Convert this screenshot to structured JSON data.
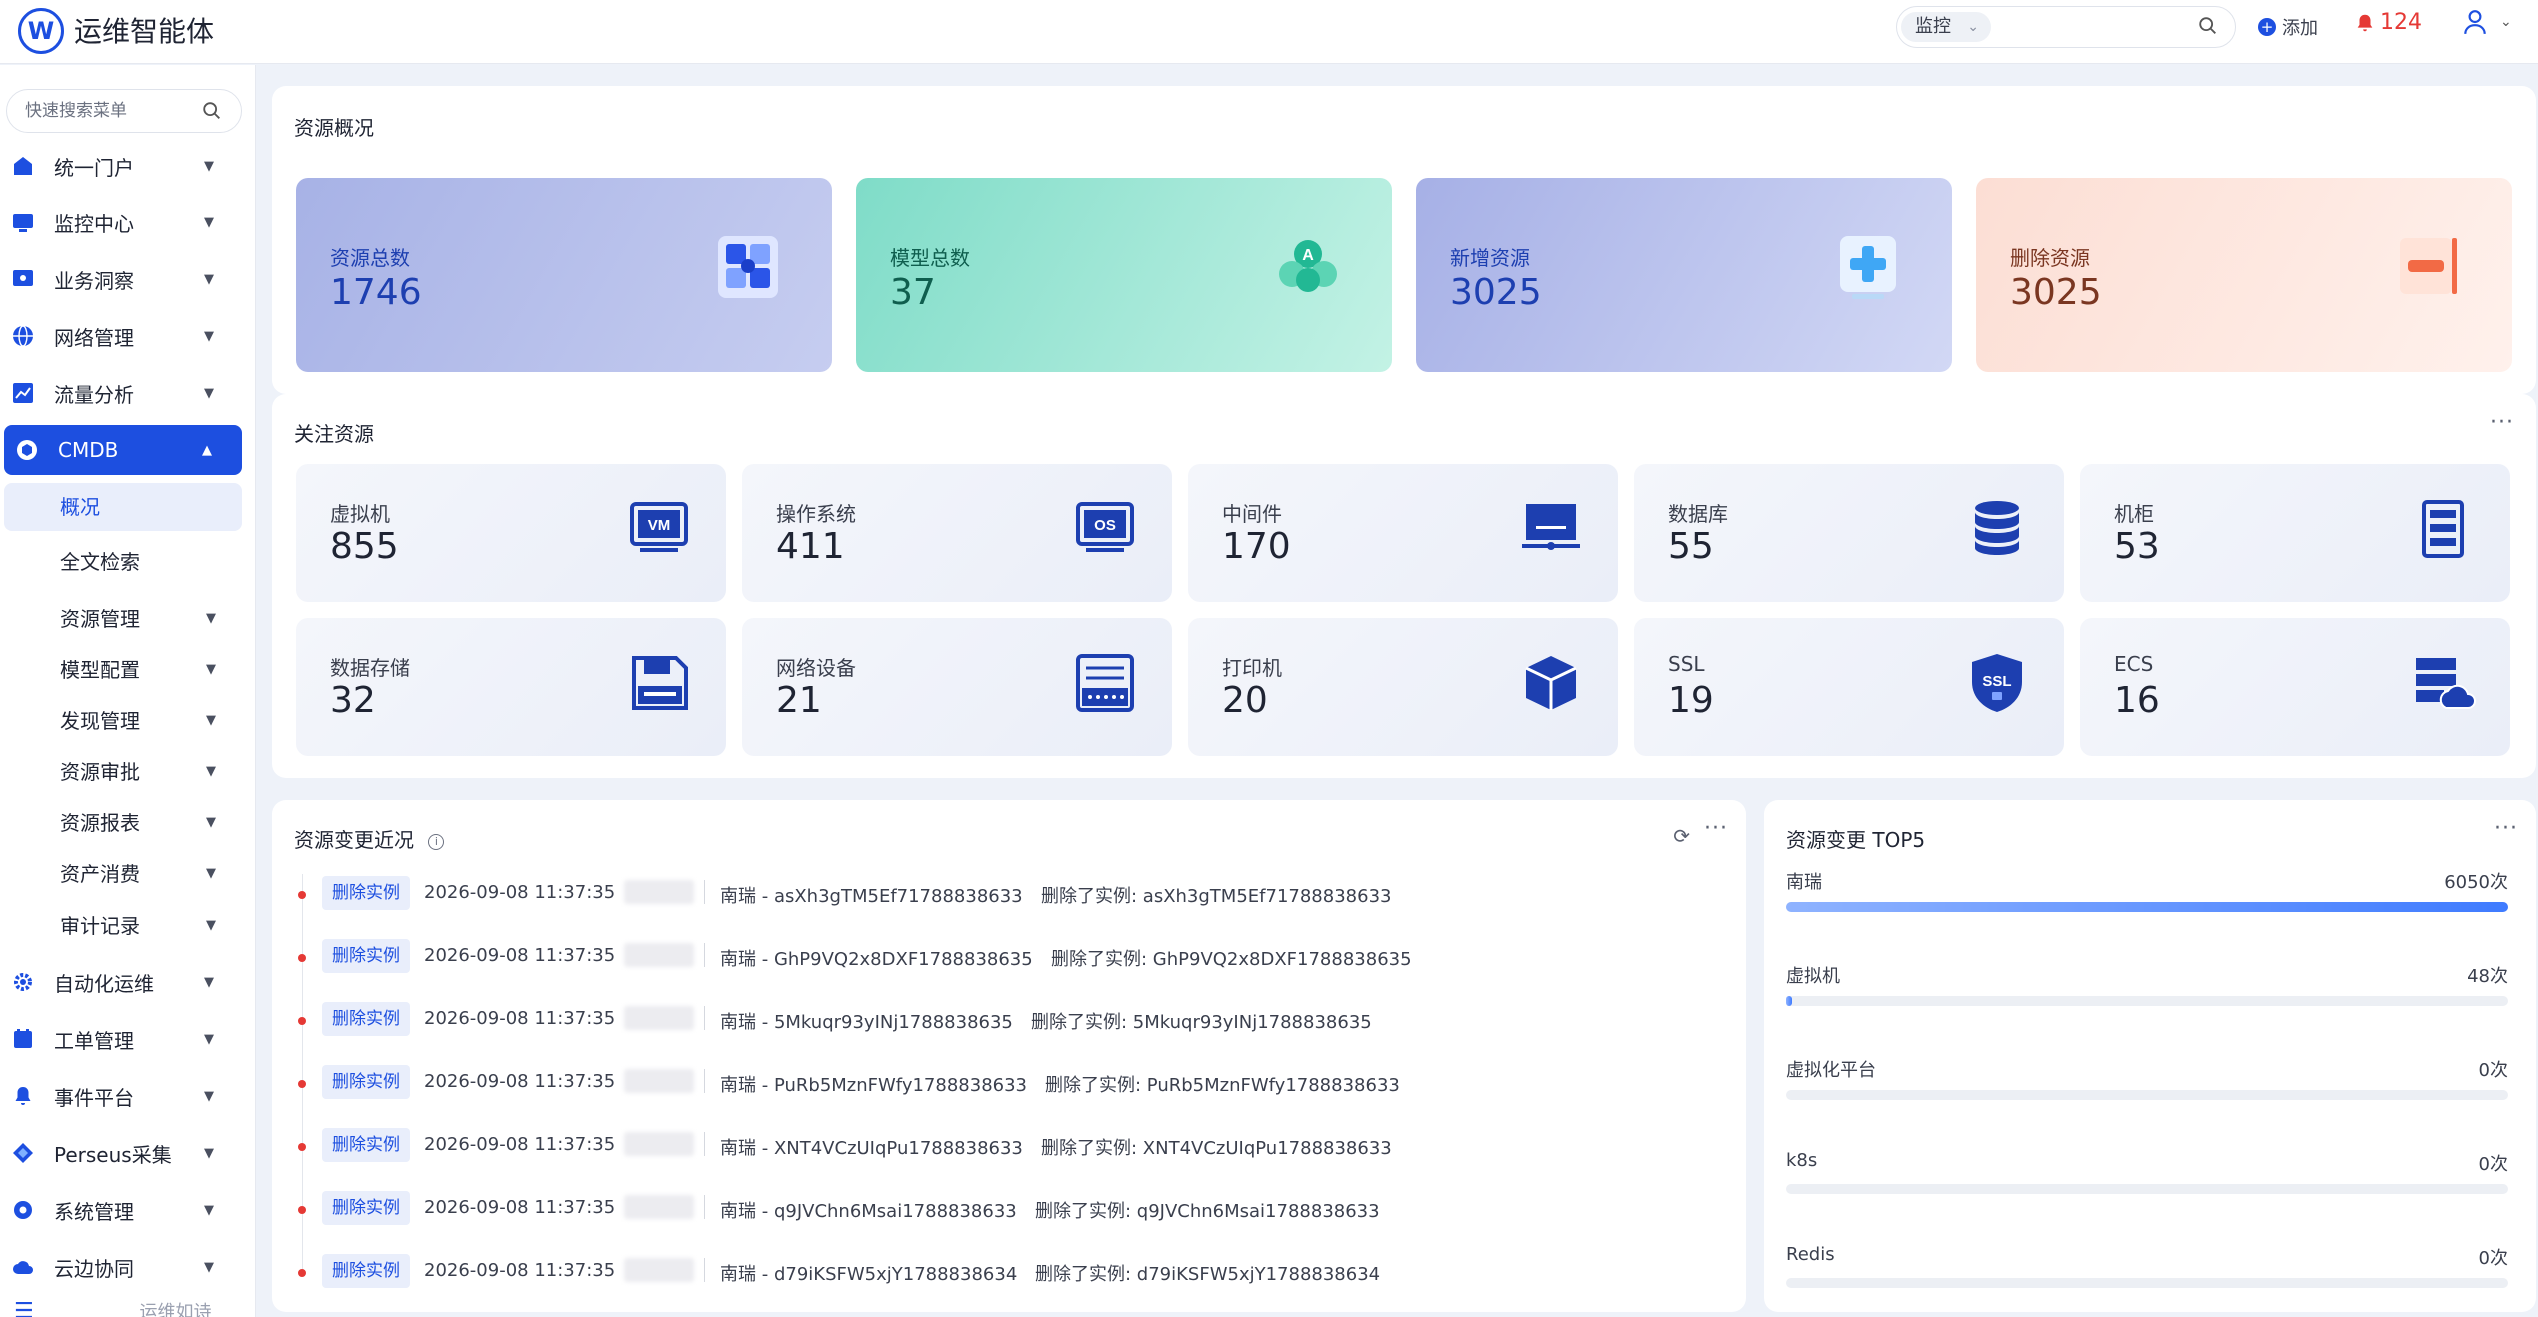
{
  "header": {
    "app_title": "运维智能体",
    "search_scope": "监控",
    "add_label": "添加",
    "alert_count": "124"
  },
  "sidebar": {
    "search_placeholder": "快速搜索菜单",
    "items": [
      {
        "label": "统一门户",
        "icon": "portal-icon"
      },
      {
        "label": "监控中心",
        "icon": "monitor-icon"
      },
      {
        "label": "业务洞察",
        "icon": "insight-icon"
      },
      {
        "label": "网络管理",
        "icon": "globe-icon"
      },
      {
        "label": "流量分析",
        "icon": "chart-icon"
      },
      {
        "label": "CMDB",
        "icon": "cmdb-icon"
      },
      {
        "label": "自动化运维",
        "icon": "gear-icon"
      },
      {
        "label": "工单管理",
        "icon": "ticket-icon"
      },
      {
        "label": "事件平台",
        "icon": "bell-icon"
      },
      {
        "label": "Perseus采集",
        "icon": "diamond-icon"
      },
      {
        "label": "系统管理",
        "icon": "settings-icon"
      },
      {
        "label": "云边协同",
        "icon": "cloud-icon"
      }
    ],
    "cmdb_sub": [
      {
        "label": "概况"
      },
      {
        "label": "全文检索"
      },
      {
        "label": "资源管理"
      },
      {
        "label": "模型配置"
      },
      {
        "label": "发现管理"
      },
      {
        "label": "资源审批"
      },
      {
        "label": "资源报表"
      },
      {
        "label": "资产消费"
      },
      {
        "label": "审计记录"
      }
    ],
    "footer": "运维如诗"
  },
  "overview": {
    "title": "资源概况",
    "cards": [
      {
        "label": "资源总数",
        "value": "1746"
      },
      {
        "label": "模型总数",
        "value": "37"
      },
      {
        "label": "新增资源",
        "value": "3025"
      },
      {
        "label": "删除资源",
        "value": "3025"
      }
    ]
  },
  "focus": {
    "title": "关注资源",
    "cards": [
      {
        "label": "虚拟机",
        "value": "855",
        "icon": "vm-icon"
      },
      {
        "label": "操作系统",
        "value": "411",
        "icon": "os-icon"
      },
      {
        "label": "中间件",
        "value": "170",
        "icon": "middleware-icon"
      },
      {
        "label": "数据库",
        "value": "55",
        "icon": "database-icon"
      },
      {
        "label": "机柜",
        "value": "53",
        "icon": "cabinet-icon"
      },
      {
        "label": "数据存储",
        "value": "32",
        "icon": "floppy-icon"
      },
      {
        "label": "网络设备",
        "value": "21",
        "icon": "network-device-icon"
      },
      {
        "label": "打印机",
        "value": "20",
        "icon": "cube-icon"
      },
      {
        "label": "SSL",
        "value": "19",
        "icon": "ssl-shield-icon"
      },
      {
        "label": "ECS",
        "value": "16",
        "icon": "ecs-icon"
      }
    ]
  },
  "changes": {
    "title": "资源变更近况",
    "rows": [
      {
        "tag": "删除实例",
        "time": "2026-09-08 11:37:35",
        "target": "南瑞 - asXh3gTM5Ef71788838633",
        "action": "删除了实例: asXh3gTM5Ef71788838633"
      },
      {
        "tag": "删除实例",
        "time": "2026-09-08 11:37:35",
        "target": "南瑞 - GhP9VQ2x8DXF1788838635",
        "action": "删除了实例: GhP9VQ2x8DXF1788838635"
      },
      {
        "tag": "删除实例",
        "time": "2026-09-08 11:37:35",
        "target": "南瑞 - 5Mkuqr93yINj1788838635",
        "action": "删除了实例: 5Mkuqr93yINj1788838635"
      },
      {
        "tag": "删除实例",
        "time": "2026-09-08 11:37:35",
        "target": "南瑞 - PuRb5MznFWfy1788838633",
        "action": "删除了实例: PuRb5MznFWfy1788838633"
      },
      {
        "tag": "删除实例",
        "time": "2026-09-08 11:37:35",
        "target": "南瑞 - XNT4VCzUIqPu1788838633",
        "action": "删除了实例: XNT4VCzUIqPu1788838633"
      },
      {
        "tag": "删除实例",
        "time": "2026-09-08 11:37:35",
        "target": "南瑞 - q9JVChn6Msai1788838633",
        "action": "删除了实例: q9JVChn6Msai1788838633"
      },
      {
        "tag": "删除实例",
        "time": "2026-09-08 11:37:35",
        "target": "南瑞 - d79iKSFW5xjY1788838634",
        "action": "删除了实例: d79iKSFW5xjY1788838634"
      }
    ]
  },
  "top5": {
    "title": "资源变更 TOP5",
    "rows": [
      {
        "name": "南瑞",
        "value": "6050次",
        "ratio": 1.0
      },
      {
        "name": "虚拟机",
        "value": "48次",
        "ratio": 0.008
      },
      {
        "name": "虚拟化平台",
        "value": "0次",
        "ratio": 0
      },
      {
        "name": "k8s",
        "value": "0次",
        "ratio": 0
      },
      {
        "name": "Redis",
        "value": "0次",
        "ratio": 0
      }
    ]
  },
  "colors": {
    "brand": "#1d4fe0",
    "alert": "#e53935"
  }
}
